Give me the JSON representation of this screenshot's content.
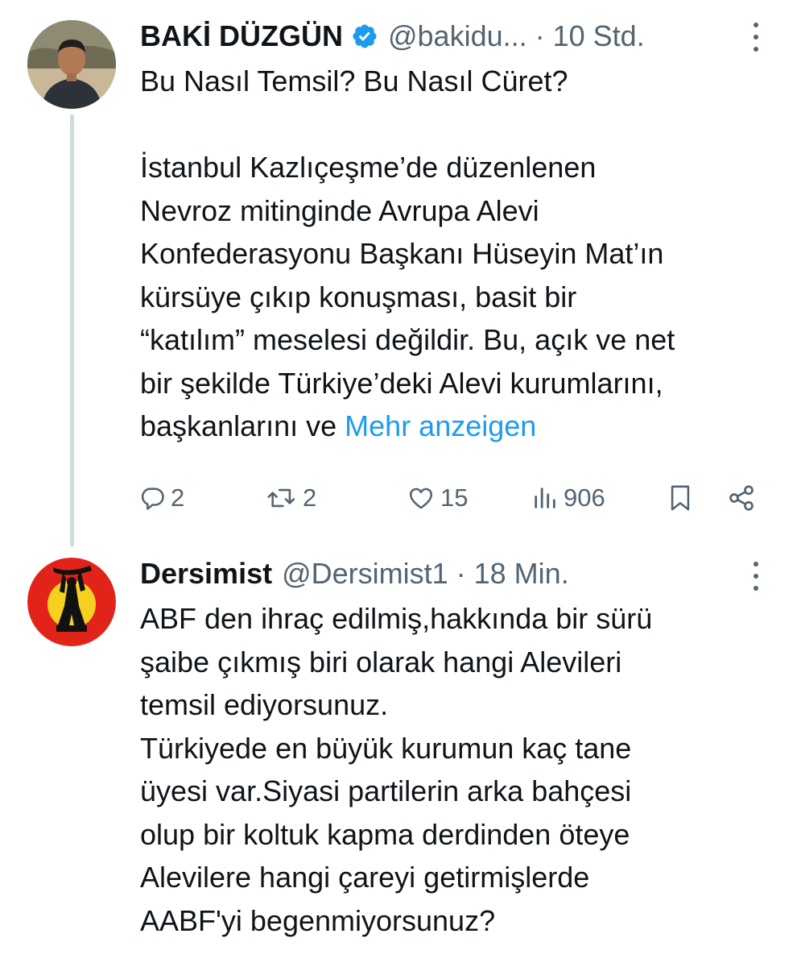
{
  "tweet1": {
    "display_name": "BAKİ DÜZGÜN",
    "handle": "@bakidu...",
    "separator": "·",
    "time": "10 Std.",
    "lines": [
      "Bu Nasıl Temsil? Bu Nasıl Cüret?",
      "",
      "İstanbul Kazlıçeşme’de düzenlenen",
      "Nevroz mitinginde Avrupa Alevi",
      "Konfederasyonu Başkanı Hüseyin Mat’ın",
      "kürsüye çıkıp konuşması, basit bir",
      "“katılım” meselesi değildir. Bu, açık ve net",
      "bir şekilde Türkiye’deki Alevi kurumlarını,"
    ],
    "last_line_text": "başkanlarını ve ",
    "show_more": "Mehr anzeigen",
    "actions": {
      "replies": "2",
      "retweets": "2",
      "likes": "15",
      "views": "906"
    }
  },
  "tweet2": {
    "display_name": "Dersimist",
    "handle": "@Dersimist1",
    "separator": "·",
    "time": "18 Min.",
    "lines": [
      "ABF den ihraç edilmiş,hakkında bir sürü",
      "şaibe çıkmış biri olarak hangi Alevileri",
      "temsil ediyorsunuz.",
      "Türkiyede en büyük kurumun kaç tane",
      "üyesi var.Siyasi partilerin arka bahçesi",
      "olup bir koltuk kapma derdinden öteye",
      "Alevilere hangi çareyi getirmişlerde",
      "AABF'yi begenmiyorsunuz?"
    ]
  },
  "icons": {
    "verified": "verified-badge-icon",
    "more": "more-options-icon",
    "reply": "reply-icon",
    "retweet": "retweet-icon",
    "like": "heart-icon",
    "views": "views-chart-icon",
    "bookmark": "bookmark-icon",
    "share": "share-icon"
  },
  "colors": {
    "text": "#0f1419",
    "muted": "#536471",
    "link": "#1d9bf0",
    "thread_line": "#cfd9de",
    "verified": "#1d9bf0"
  }
}
